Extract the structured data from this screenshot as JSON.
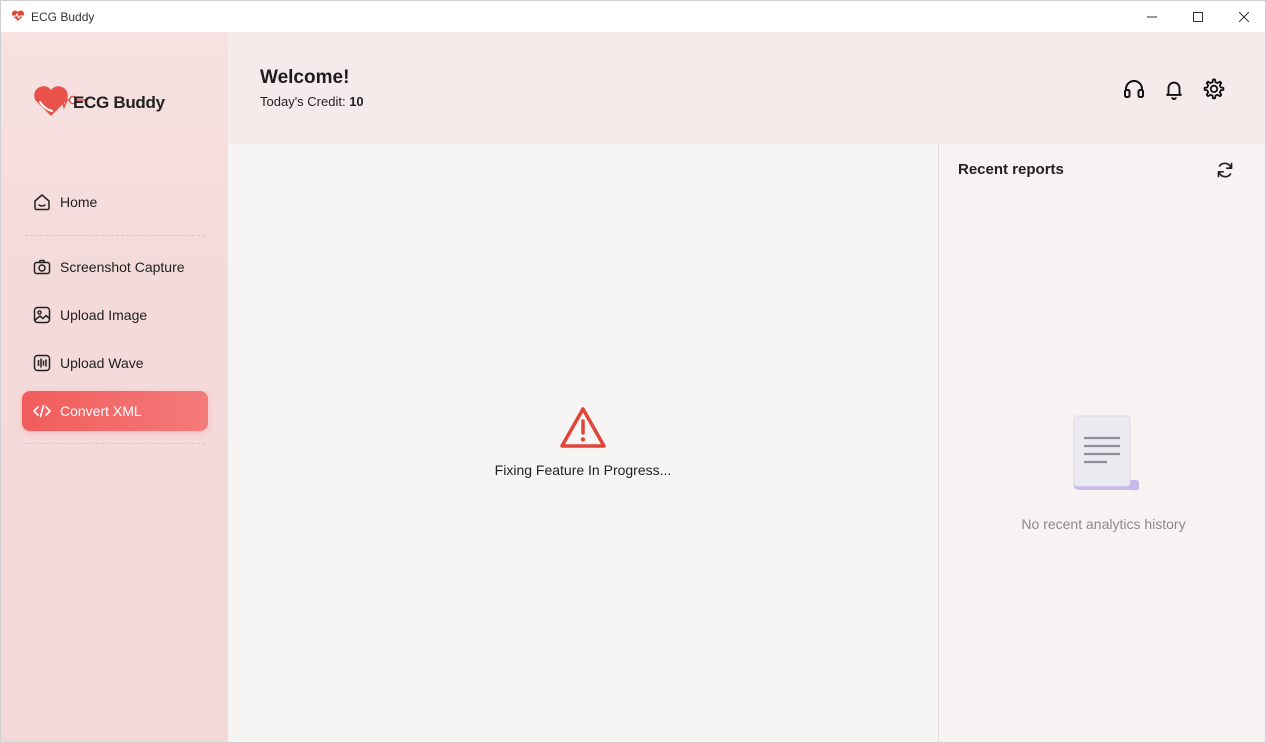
{
  "window": {
    "title": "ECG Buddy",
    "controls": [
      "minimize",
      "maximize",
      "close"
    ]
  },
  "sidebar": {
    "logo_text": "ECG Buddy",
    "items": [
      {
        "label": "Home",
        "icon": "home-icon",
        "active": false
      },
      {
        "label": "Screenshot Capture",
        "icon": "camera-icon",
        "active": false
      },
      {
        "label": "Upload Image",
        "icon": "image-icon",
        "active": false
      },
      {
        "label": "Upload Wave",
        "icon": "wave-icon",
        "active": false
      },
      {
        "label": "Convert XML",
        "icon": "code-icon",
        "active": true
      }
    ]
  },
  "header": {
    "welcome": "Welcome!",
    "credit_label": "Today's Credit:",
    "credit_value": "10",
    "icons": [
      "headset-icon",
      "bell-icon",
      "gear-icon"
    ]
  },
  "main": {
    "status_icon": "warning-icon",
    "status_text": "Fixing Feature In Progress..."
  },
  "recent_reports": {
    "title": "Recent reports",
    "empty_text": "No recent analytics history",
    "refresh_icon": "refresh-icon"
  },
  "colors": {
    "accent": "#f25c5c",
    "warning": "#e0453a",
    "sidebar_bg": "#f4dada"
  }
}
